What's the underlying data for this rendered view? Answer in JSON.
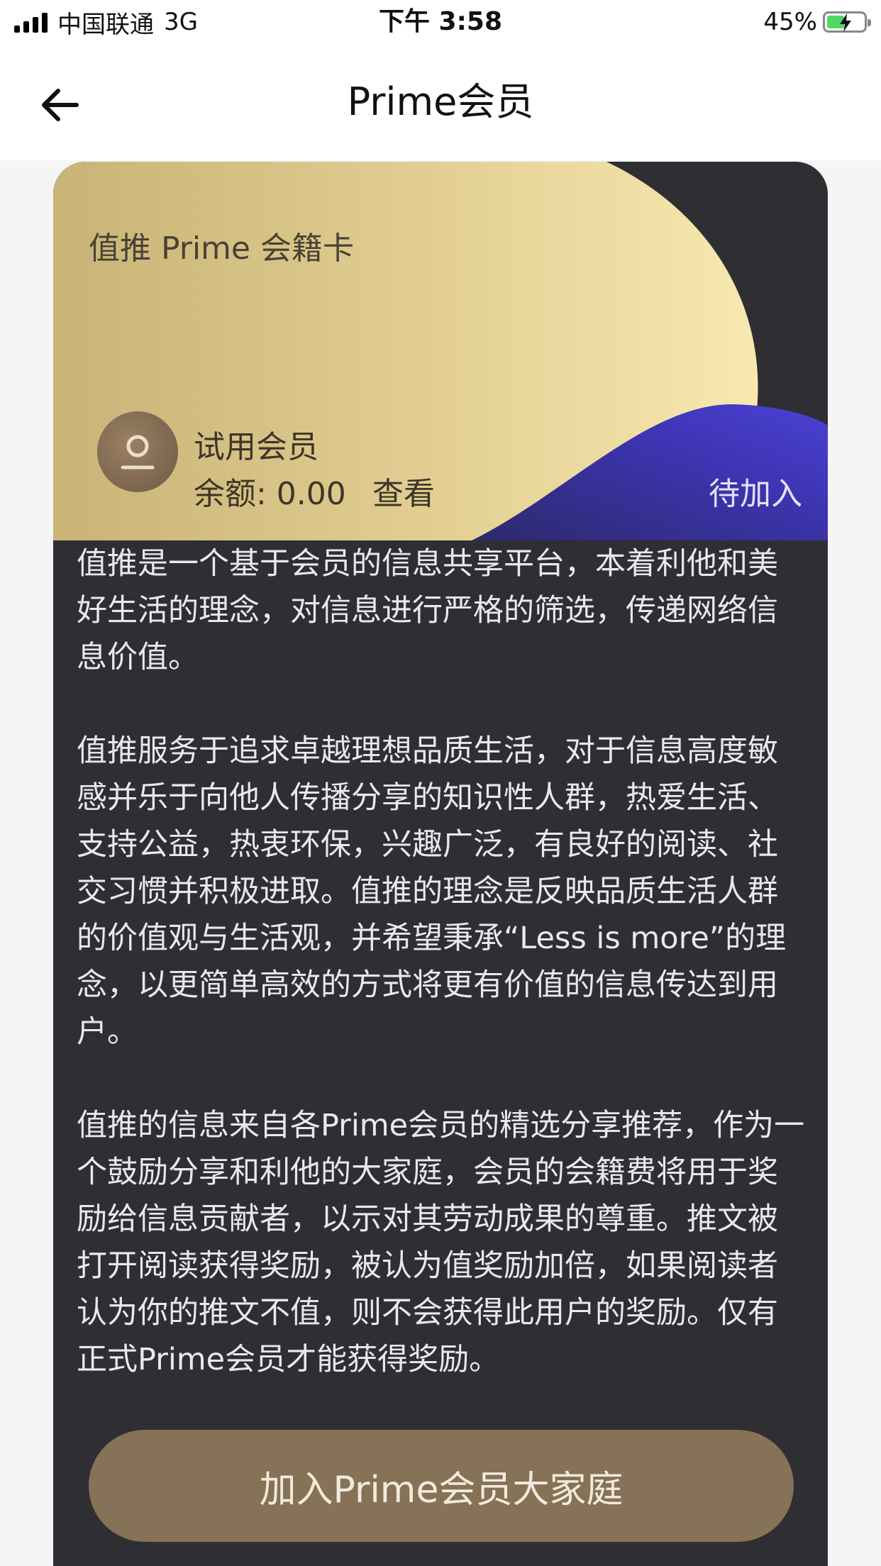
{
  "status_bar": {
    "carrier": "中国联通",
    "network": "3G",
    "time": "下午 3:58",
    "battery_percent": "45%",
    "battery_level": 0.45,
    "icons": [
      "signal-icon",
      "battery-charging-icon"
    ]
  },
  "nav": {
    "title": "Prime会员",
    "back_icon": "back-arrow-icon"
  },
  "card": {
    "title": "值推 Prime 会籍卡",
    "member_type": "试用会员",
    "balance": "余额: 0.00",
    "view_link": "查看",
    "status": "待加入",
    "avatar_icon": "user-avatar-icon",
    "colors": {
      "gold": "#e9d596",
      "purple": "#4a3fcb",
      "dark": "#2f2e33"
    }
  },
  "content": {
    "paragraphs": [
      "值推是一个基于会员的信息共享平台，本着利他和美好生活的理念，对信息进行严格的筛选，传递网络信息价值。",
      "值推服务于追求卓越理想品质生活，对于信息高度敏感并乐于向他人传播分享的知识性人群，热爱生活、支持公益，热衷环保，兴趣广泛，有良好的阅读、社交习惯并积极进取。值推的理念是反映品质生活人群的价值观与生活观，并希望秉承“Less is more”的理念，以更简单高效的方式将更有价值的信息传达到用户。",
      "值推的信息来自各Prime会员的精选分享推荐，作为一个鼓励分享和利他的大家庭，会员的会籍费将用于奖励给信息贡献者，以示对其劳动成果的尊重。推文被打开阅读获得奖励，被认为值奖励加倍，如果阅读者认为你的推文不值，则不会获得此用户的奖励。仅有正式Prime会员才能获得奖励。"
    ]
  },
  "join_button": {
    "label": "加入Prime会员大家庭",
    "color": "#857257"
  }
}
